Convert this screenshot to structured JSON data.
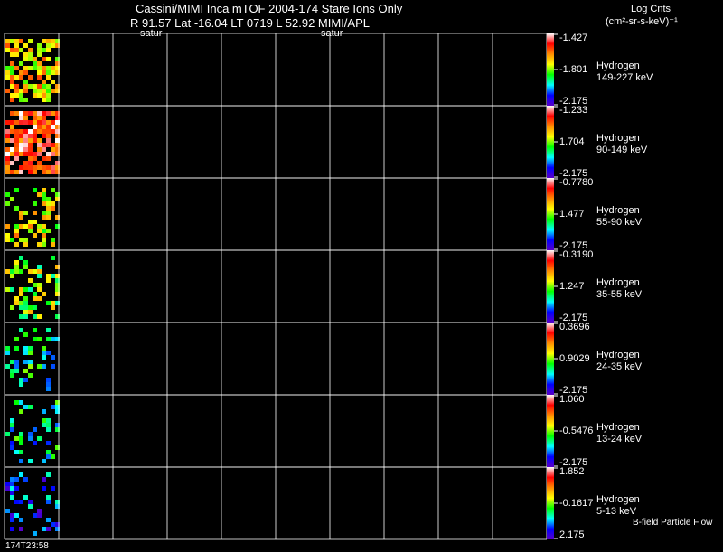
{
  "header": {
    "title_line1": "Cassini/MIMI Inca mTOF  2004-174    Stare    Ions Only",
    "title_line2": "R        91.57 Lat -16.04 LT 0719 L        52.92  MIMI/APL",
    "satur_left": "satur",
    "satur_right": "satur",
    "units_line1": "Log Cnts",
    "units_line2": "(cm²-sr-s-keV)⁻¹"
  },
  "footer": {
    "time": "174T23:58",
    "bfield": "B-field Particle Flow"
  },
  "chart_data": {
    "type": "heatmap",
    "grid": true,
    "colorscale": [
      "#ffffff",
      "#ff0000",
      "#ff8c00",
      "#ffff00",
      "#00ff00",
      "#00ffff",
      "#0000ff",
      "#5a00c8"
    ],
    "panels": [
      {
        "species": "Hydrogen",
        "energy": "149-227 keV",
        "cb_top": "-1.427",
        "cb_mid": "-1.801",
        "cb_bottom": "-2.175",
        "level": 0.62,
        "density": 0.55
      },
      {
        "species": "Hydrogen",
        "energy": "90-149 keV",
        "cb_top": "-1.233",
        "cb_mid": "1.704",
        "cb_bottom": "-2.175",
        "level": 0.85,
        "density": 0.75
      },
      {
        "species": "Hydrogen",
        "energy": "55-90 keV",
        "cb_top": "-0.7780",
        "cb_mid": "1.477",
        "cb_bottom": "-2.175",
        "level": 0.58,
        "density": 0.35
      },
      {
        "species": "Hydrogen",
        "energy": "35-55 keV",
        "cb_top": "-0.3190",
        "cb_mid": "1.247",
        "cb_bottom": "-2.175",
        "level": 0.5,
        "density": 0.3
      },
      {
        "species": "Hydrogen",
        "energy": "24-35 keV",
        "cb_top": "0.3696",
        "cb_mid": "0.9029",
        "cb_bottom": "-2.175",
        "level": 0.35,
        "density": 0.2
      },
      {
        "species": "Hydrogen",
        "energy": "13-24 keV",
        "cb_top": "1.060",
        "cb_mid": "-0.5476",
        "cb_bottom": "-2.175",
        "level": 0.32,
        "density": 0.25
      },
      {
        "species": "Hydrogen",
        "energy": "5-13 keV",
        "cb_top": "1.852",
        "cb_mid": "-0.1617",
        "cb_bottom": "2.175",
        "level": 0.18,
        "density": 0.22
      }
    ]
  }
}
